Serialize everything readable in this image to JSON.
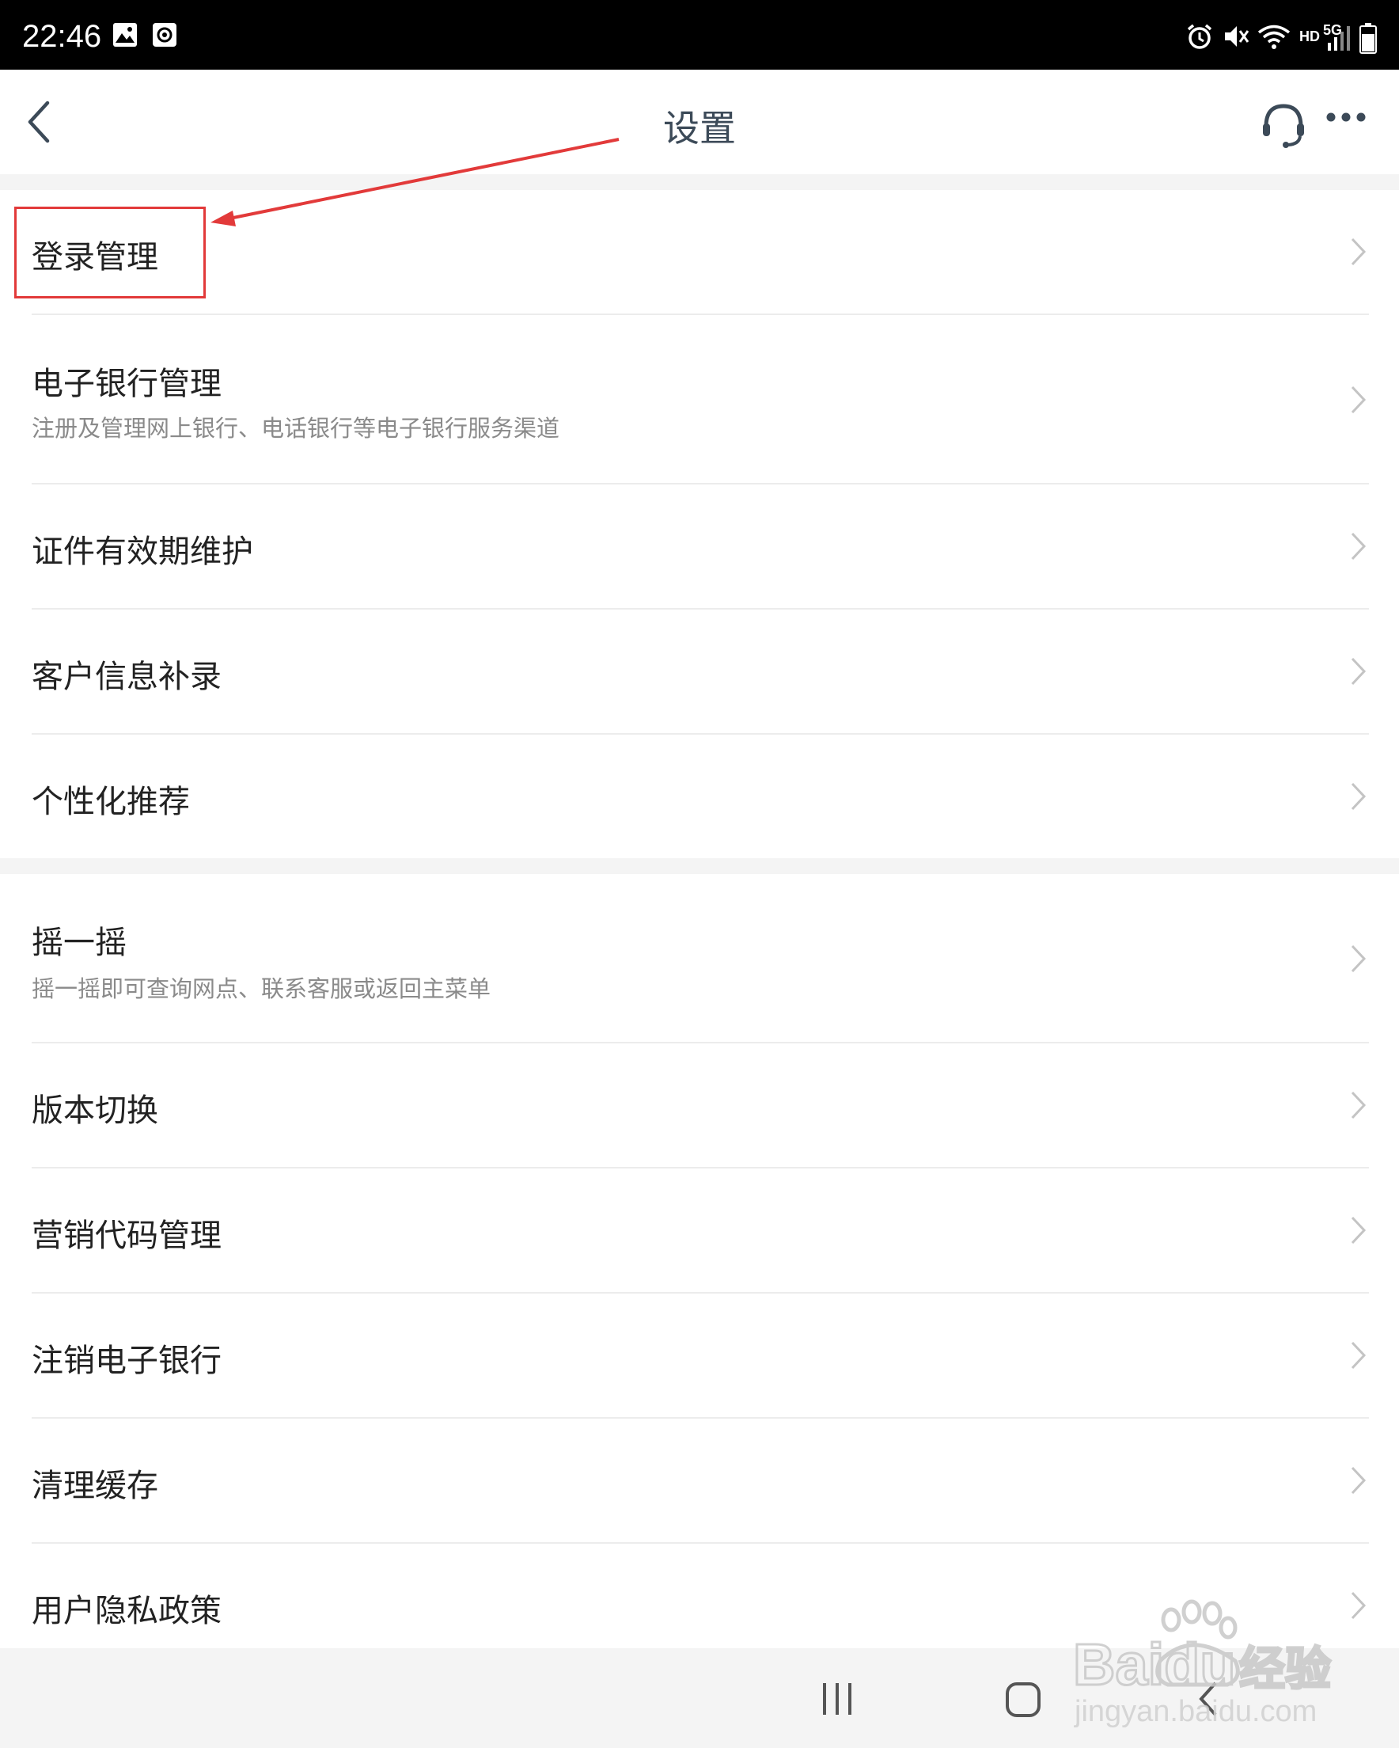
{
  "status_bar": {
    "time": "22:46",
    "network_hd": "HD",
    "network_5g": "5G",
    "icons": [
      "image-icon",
      "screen-record-icon",
      "alarm-icon",
      "mute-icon",
      "wifi-icon",
      "signal-icon",
      "battery-icon"
    ]
  },
  "header": {
    "title": "设置",
    "back_icon": "chevron-left-icon",
    "support_icon": "headset-icon",
    "more_icon": "more-dots-icon"
  },
  "group1": [
    {
      "title": "登录管理",
      "subtitle": ""
    },
    {
      "title": "电子银行管理",
      "subtitle": "注册及管理网上银行、电话银行等电子银行服务渠道"
    },
    {
      "title": "证件有效期维护",
      "subtitle": ""
    },
    {
      "title": "客户信息补录",
      "subtitle": ""
    },
    {
      "title": "个性化推荐",
      "subtitle": ""
    }
  ],
  "group2": [
    {
      "title": "摇一摇",
      "subtitle": "摇一摇即可查询网点、联系客服或返回主菜单"
    },
    {
      "title": "版本切换",
      "subtitle": ""
    },
    {
      "title": "营销代码管理",
      "subtitle": ""
    },
    {
      "title": "注销电子银行",
      "subtitle": ""
    },
    {
      "title": "清理缓存",
      "subtitle": ""
    },
    {
      "title": "用户隐私政策",
      "subtitle": ""
    }
  ],
  "annotation": {
    "color": "#e23a3a",
    "target": "登录管理"
  },
  "watermark": {
    "brand": "Baidu",
    "brand_cn": "经验",
    "url": "jingyan.baidu.com"
  },
  "colors": {
    "title_text": "#3c4a58",
    "item_text": "#222222",
    "subtitle_text": "#8a8a8a",
    "chevron": "#c4c4c4",
    "annotation": "#e23a3a",
    "page_bg": "#f4f4f4"
  }
}
